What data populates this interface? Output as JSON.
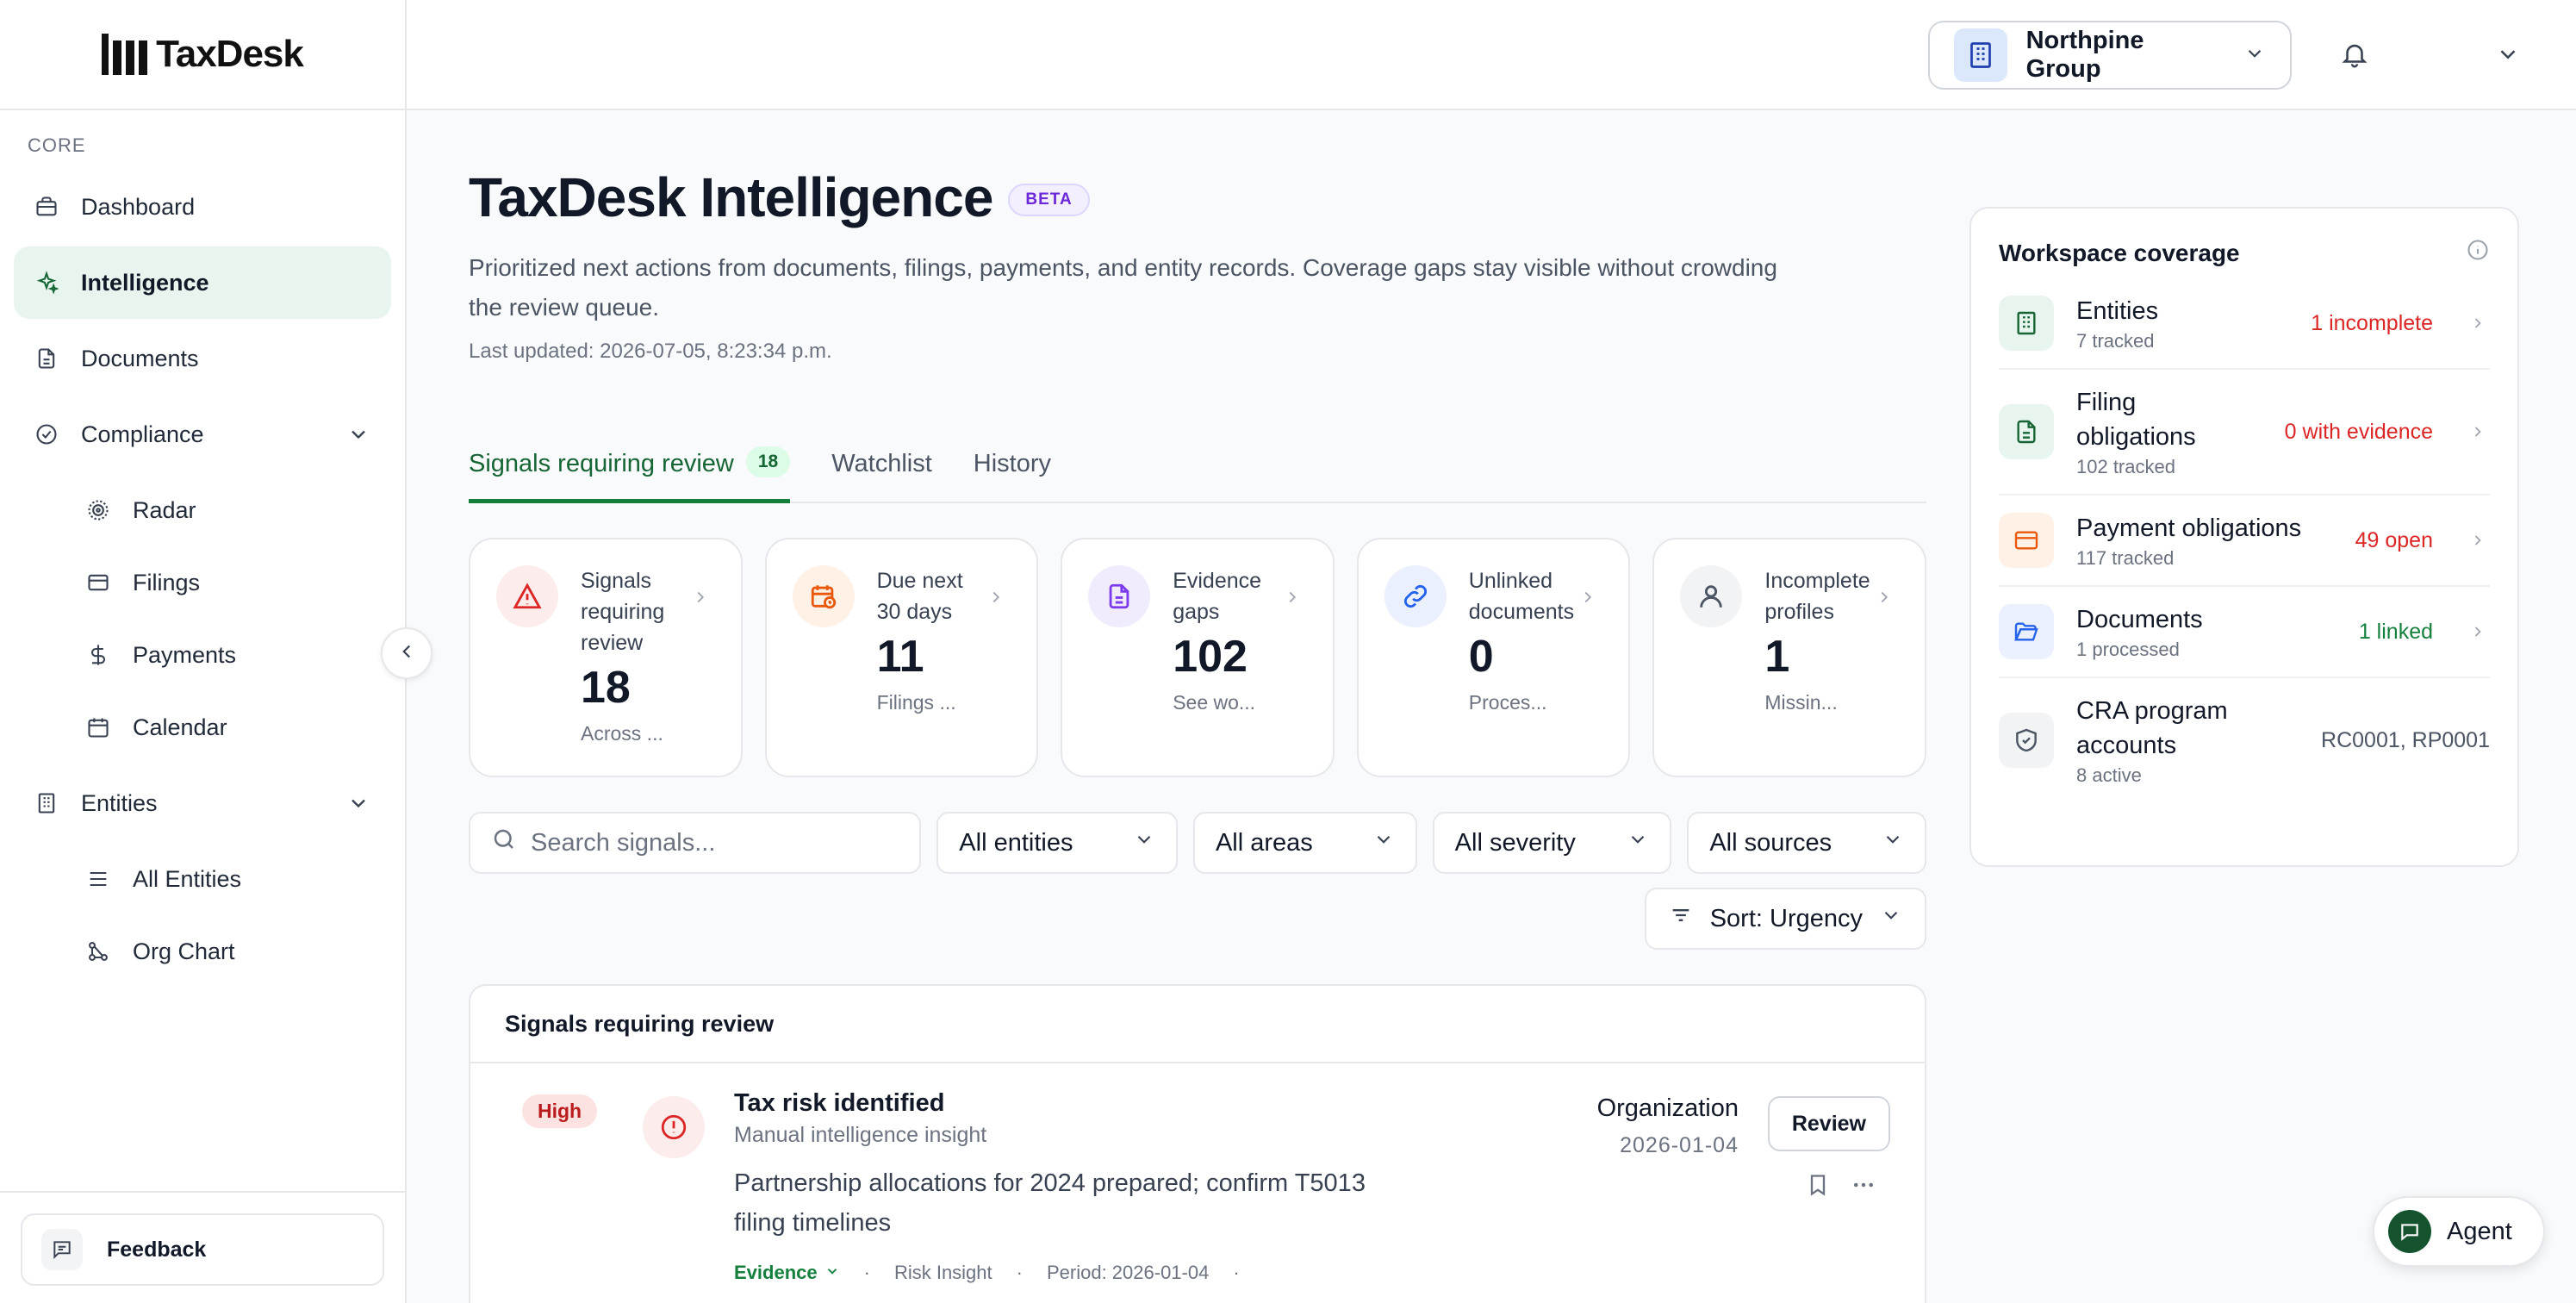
{
  "app": {
    "name": "TaxDesk"
  },
  "sidebar": {
    "section_label": "CORE",
    "items": {
      "dashboard": "Dashboard",
      "intelligence": "Intelligence",
      "documents": "Documents",
      "compliance": "Compliance",
      "radar": "Radar",
      "filings": "Filings",
      "payments": "Payments",
      "calendar": "Calendar",
      "entities": "Entities",
      "all_entities": "All Entities",
      "org_chart": "Org Chart"
    },
    "feedback": "Feedback"
  },
  "header": {
    "org_name": "Northpine Group"
  },
  "page": {
    "title": "TaxDesk Intelligence",
    "badge": "BETA",
    "subtitle": "Prioritized next actions from documents, filings, payments, and entity records. Coverage gaps stay visible without crowding the review queue.",
    "last_updated": "Last updated: 2026-07-05, 8:23:34 p.m."
  },
  "tabs": [
    {
      "label": "Signals requiring review",
      "count": "18"
    },
    {
      "label": "Watchlist"
    },
    {
      "label": "History"
    }
  ],
  "stats": [
    {
      "label": "Signals requiring review",
      "value": "18",
      "sub": "Across ...",
      "icon": "alert-triangle-icon",
      "color": "#dc2626"
    },
    {
      "label": "Due next 30 days",
      "value": "11",
      "sub": "Filings ...",
      "icon": "calendar-clock-icon",
      "color": "#ea580c"
    },
    {
      "label": "Evidence gaps",
      "value": "102",
      "sub": "See wo...",
      "icon": "file-text-icon",
      "color": "#7c3aed"
    },
    {
      "label": "Unlinked documents",
      "value": "0",
      "sub": "Proces...",
      "icon": "link-icon",
      "color": "#2563eb"
    },
    {
      "label": "Incomplete profiles",
      "value": "1",
      "sub": "Missin...",
      "icon": "user-icon",
      "color": "#4b5563"
    }
  ],
  "filters": {
    "search_placeholder": "Search signals...",
    "entities": "All entities",
    "areas": "All areas",
    "severity": "All severity",
    "sources": "All sources",
    "sort": "Sort: Urgency"
  },
  "signals_panel": {
    "title": "Signals requiring review",
    "rows": [
      {
        "severity": "High",
        "title": "Tax risk identified",
        "source": "Manual intelligence insight",
        "description": "Partnership allocations for 2024 prepared; confirm T5013 filing timelines",
        "entity": "Organization",
        "date": "2026-01-04",
        "review_label": "Review",
        "evidence_label": "Evidence",
        "category": "Risk Insight",
        "period": "Period: 2026-01-04"
      }
    ]
  },
  "coverage": {
    "title": "Workspace coverage",
    "items": [
      {
        "name": "Entities",
        "sub": "7 tracked",
        "status": "1 incomplete",
        "status_color": "#dc2626",
        "icon": "building-icon"
      },
      {
        "name": "Filing obligations",
        "sub": "102 tracked",
        "status": "0 with evidence",
        "status_color": "#dc2626",
        "icon": "file-text-icon"
      },
      {
        "name": "Payment obligations",
        "sub": "117 tracked",
        "status": "49 open",
        "status_color": "#dc2626",
        "icon": "credit-card-icon"
      },
      {
        "name": "Documents",
        "sub": "1 processed",
        "status": "1 linked",
        "status_color": "#15803d",
        "icon": "folder-open-icon"
      },
      {
        "name": "CRA program accounts",
        "sub": "8 active",
        "status": "RC0001, RP0001",
        "status_color": "#4b5563",
        "icon": "shield-check-icon"
      }
    ]
  },
  "agent": {
    "label": "Agent"
  }
}
